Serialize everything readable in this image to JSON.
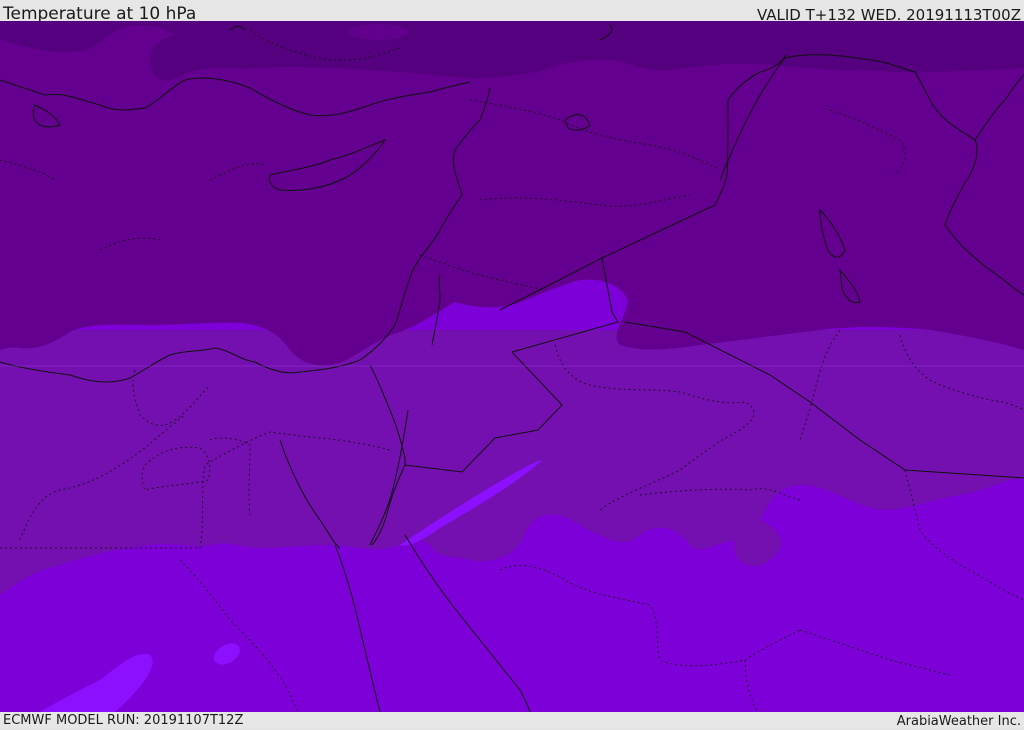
{
  "header": {
    "title": "Temperature at 10 hPa",
    "valid_time": "VALID T+132 WED. 20191113T00Z"
  },
  "footer": {
    "model_run": "ECMWF MODEL RUN: 20191107T12Z",
    "credit": "ArabiaWeather Inc."
  },
  "map": {
    "variable": "Temperature",
    "level": "10 hPa",
    "region": "Eastern Mediterranean / Middle East",
    "colors": {
      "band_darkest": "#55007f",
      "band_dark": "#64008f",
      "band_mid": "#7410b0",
      "band_light": "#7e00d8",
      "band_lightest": "#8c10ff",
      "borders": "#111111"
    }
  }
}
